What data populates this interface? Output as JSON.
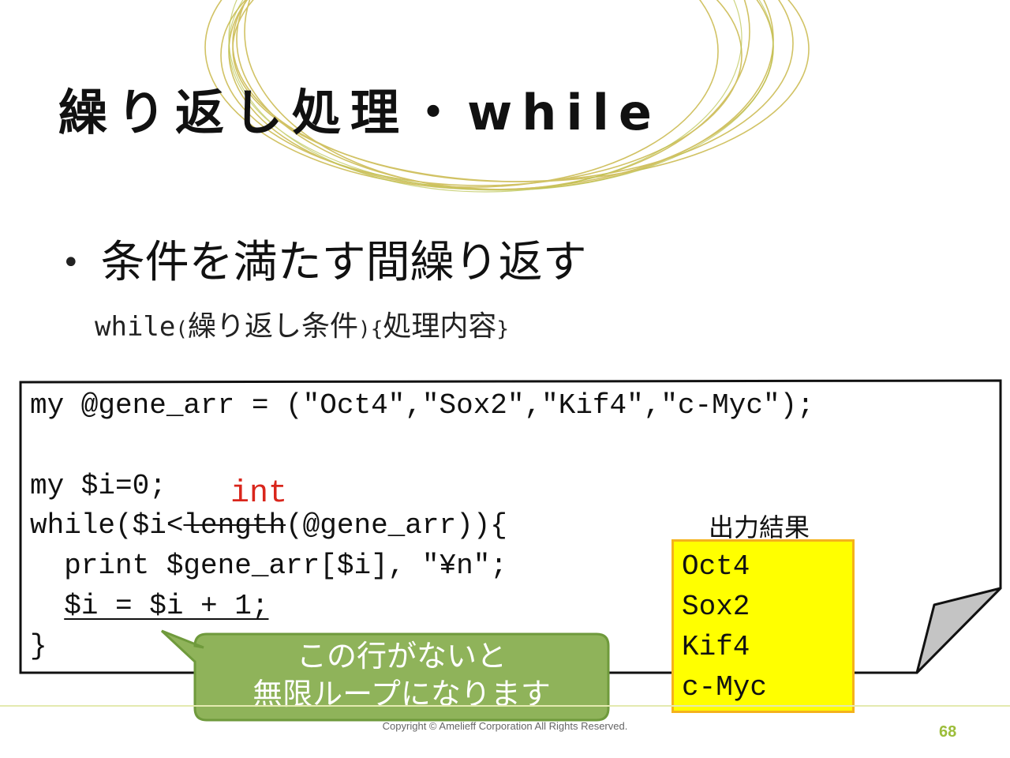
{
  "slide": {
    "title": "繰り返し処理・while",
    "bullet": "条件を満たす間繰り返す",
    "syntax": {
      "keyword": "while",
      "open_paren": "(",
      "condition": "繰り返し条件",
      "close_paren": ")",
      "open_brace": "{",
      "body": "処理内容",
      "close_brace": "}"
    }
  },
  "code": {
    "line1": "my @gene_arr = (\"Oct4\",\"Sox2\",\"Kif4\",\"c-Myc\");",
    "line2": "my $i=0;",
    "line3_prefix": "while($i<",
    "line3_struck": "length",
    "line3_suffix": "(@gene_arr)){",
    "line4": "  print $gene_arr[$i], \"¥n\";",
    "line5_indent": "  ",
    "line5": "$i = $i + 1;",
    "line6": "}"
  },
  "annotation": {
    "replacement": "int",
    "callout_line1": "この行がないと",
    "callout_line2": "無限ループになります"
  },
  "output": {
    "caption": "出力結果",
    "lines": [
      "Oct4",
      "Sox2",
      "Kif4",
      "c-Myc"
    ]
  },
  "footer": {
    "copyright": "Copyright © Amelieff Corporation All Rights Reserved.",
    "page_number": "68"
  },
  "colors": {
    "deco_circles": "#c9b84a",
    "replacement_text": "#d9261c",
    "callout_fill": "#8fb35a",
    "callout_border": "#6f9a3c",
    "output_fill": "#ffff00",
    "output_border": "#f5b21c",
    "page_number": "#9cbd3a"
  }
}
